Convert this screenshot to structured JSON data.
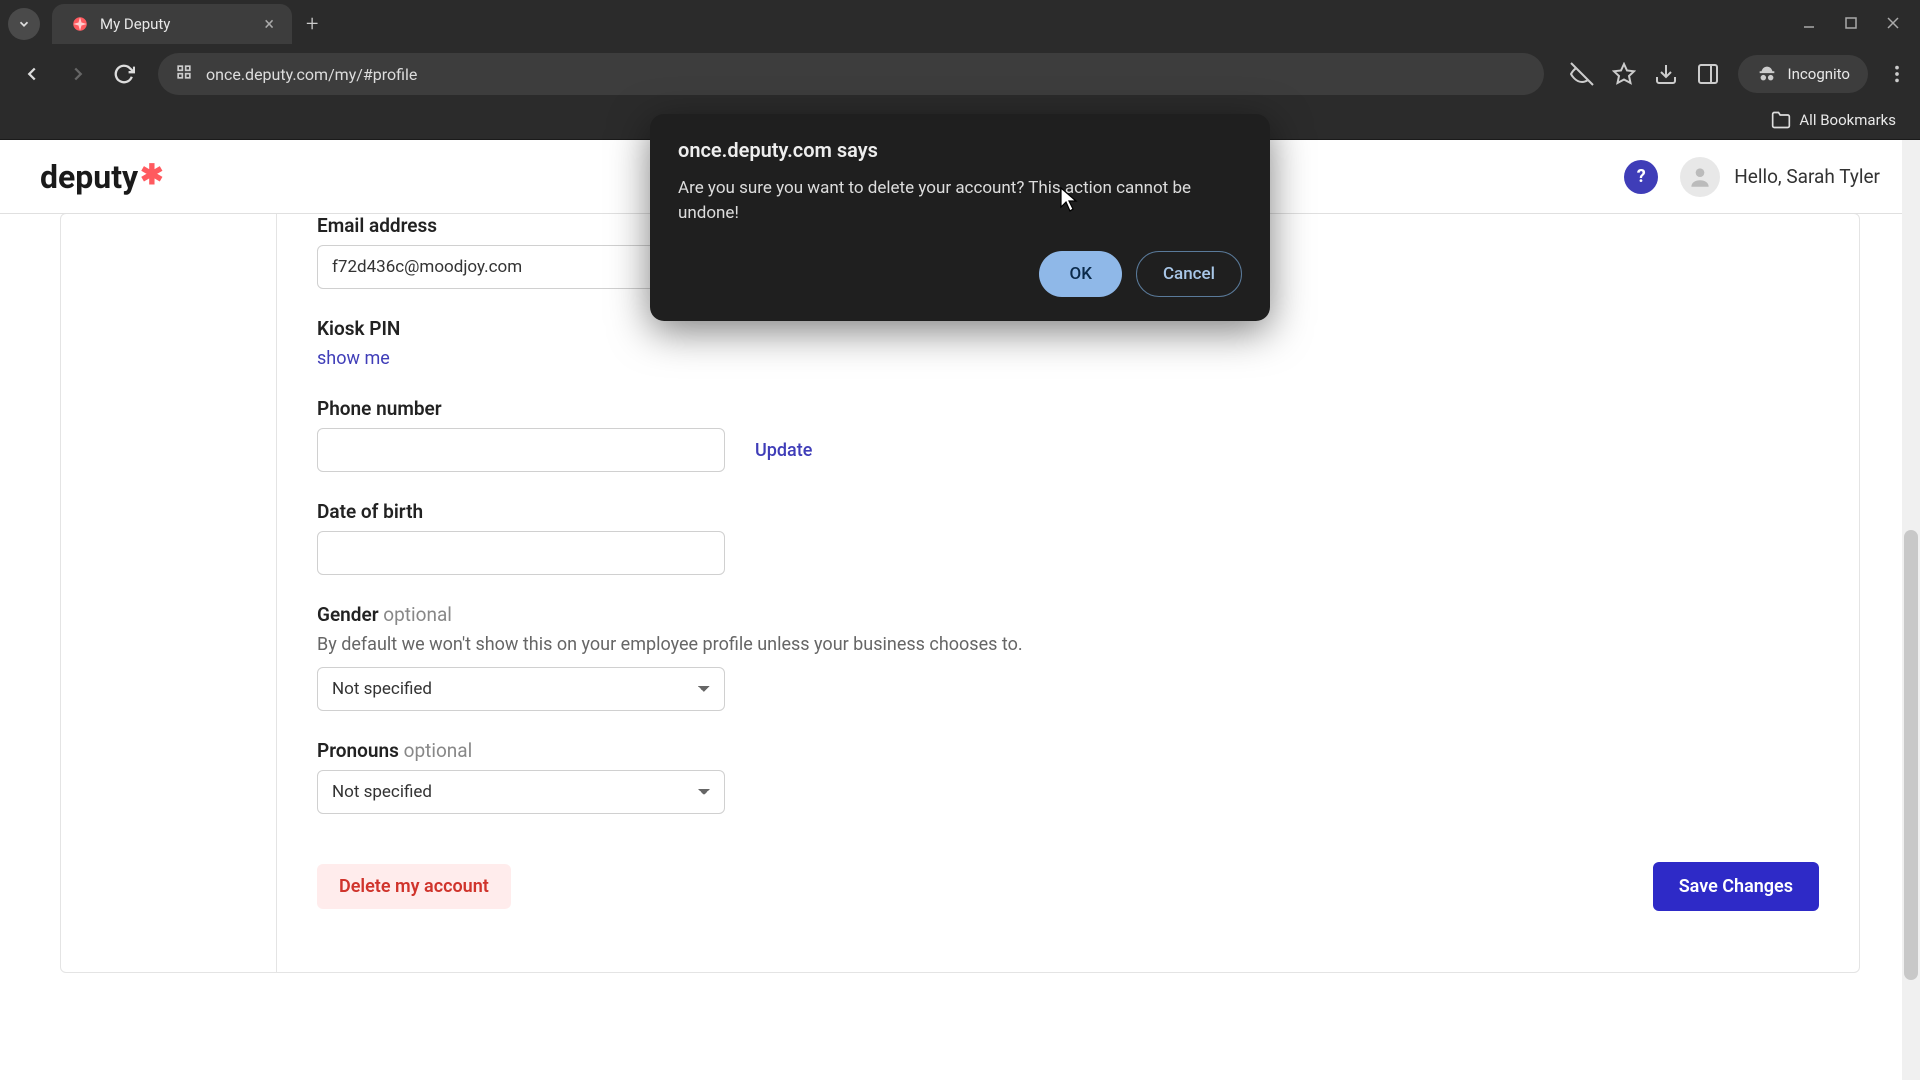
{
  "browser": {
    "tab_title": "My Deputy",
    "url": "once.deputy.com/my/#profile",
    "incognito_label": "Incognito",
    "all_bookmarks": "All Bookmarks"
  },
  "header": {
    "logo": "deputy",
    "greeting": "Hello, Sarah Tyler"
  },
  "form": {
    "email_label": "Email address",
    "email_value": "f72d436c@moodjoy.com",
    "kiosk_label": "Kiosk PIN",
    "kiosk_action": "show me",
    "phone_label": "Phone number",
    "phone_value": "",
    "phone_action": "Update",
    "dob_label": "Date of birth",
    "dob_value": "",
    "gender_label": "Gender",
    "gender_optional": "optional",
    "gender_helper": "By default we won't show this on your employee profile unless your business chooses to.",
    "gender_value": "Not specified",
    "pronouns_label": "Pronouns",
    "pronouns_optional": "optional",
    "pronouns_value": "Not specified",
    "delete_label": "Delete my account",
    "save_label": "Save Changes"
  },
  "dialog": {
    "title": "once.deputy.com says",
    "message": "Are you sure you want to delete your account? This action cannot be undone!",
    "ok": "OK",
    "cancel": "Cancel"
  }
}
